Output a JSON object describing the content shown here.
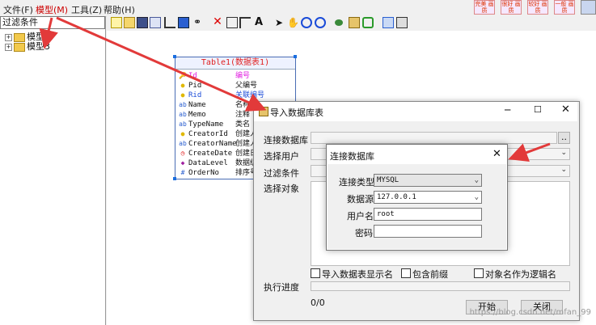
{
  "menu": {
    "file": "文件(F)",
    "model": "模型(M)",
    "tools": "工具(Z)",
    "help": "帮助(H)"
  },
  "top_buttons": [
    {
      "label": "完美 画质",
      "icon": "quality-perfect-icon"
    },
    {
      "label": "很好 画质",
      "icon": "quality-good-icon"
    },
    {
      "label": "较好 画质",
      "icon": "quality-fair-icon"
    },
    {
      "label": "一般 画质",
      "icon": "quality-normal-icon"
    }
  ],
  "toolbar_icons": [
    "new-icon",
    "open-icon",
    "save-icon",
    "copy-icon",
    "tree-icon",
    "cube-icon",
    "binoculars-icon",
    "delete-icon",
    "table-icon",
    "relation-icon",
    "text-icon",
    "pointer-icon",
    "hand-icon",
    "zoom-in-icon",
    "zoom-out-icon",
    "eye-icon",
    "import-icon",
    "refresh-icon",
    "export-icon",
    "settings-icon"
  ],
  "sidebar": {
    "filter_placeholder": "过滤条件",
    "items": [
      {
        "label": "模型1"
      },
      {
        "label": "模型3"
      }
    ]
  },
  "entity": {
    "title": "Table1(数据表1)",
    "fields": [
      {
        "name": "Id",
        "comment": "编号",
        "icon": "key-icon",
        "color": "#e020e0"
      },
      {
        "name": "Pid",
        "comment": "父编号",
        "icon": "fk-icon",
        "color": "#111111"
      },
      {
        "name": "Rid",
        "comment": "关联编号",
        "icon": "fk-icon",
        "color": "#1a4bd8"
      },
      {
        "name": "Name",
        "comment": "名称",
        "icon": "text-field-icon",
        "color": "#111111"
      },
      {
        "name": "Memo",
        "comment": "注释",
        "icon": "text-field-icon",
        "color": "#111111"
      },
      {
        "name": "TypeName",
        "comment": "类名",
        "icon": "text-field-icon",
        "color": "#111111"
      },
      {
        "name": "CreatorId",
        "comment": "创建人",
        "icon": "fk-icon",
        "color": "#111111"
      },
      {
        "name": "CreatorName",
        "comment": "创建人",
        "icon": "text-field-icon",
        "color": "#111111"
      },
      {
        "name": "CreateDate",
        "comment": "创建日",
        "icon": "clock-icon",
        "color": "#111111"
      },
      {
        "name": "DataLevel",
        "comment": "数据级",
        "icon": "diamond-icon",
        "color": "#111111"
      },
      {
        "name": "OrderNo",
        "comment": "排序号",
        "icon": "number-icon",
        "color": "#111111"
      }
    ]
  },
  "import_dialog": {
    "title": "导入数据库表",
    "labels": {
      "connection": "连接数据库",
      "user": "选择用户",
      "filter": "过滤条件",
      "objects": "选择对象",
      "progress": "执行进度"
    },
    "browse": "..",
    "checkbox_label": "导入数据表显示名",
    "checkbox_b": "包含前缀",
    "checkbox_c": "对象名作为逻辑名",
    "progress_text": "0/0",
    "start": "开始",
    "close": "关闭"
  },
  "connect_dialog": {
    "title": "连接数据库",
    "labels": {
      "type": "连接类型",
      "source": "数据源",
      "user": "用户名",
      "password": "密码"
    },
    "values": {
      "type": "MYSQL",
      "source": "127.0.0.1",
      "user": "root",
      "password": ""
    }
  },
  "watermark": "https://blog.csdn.net/mfan_99"
}
